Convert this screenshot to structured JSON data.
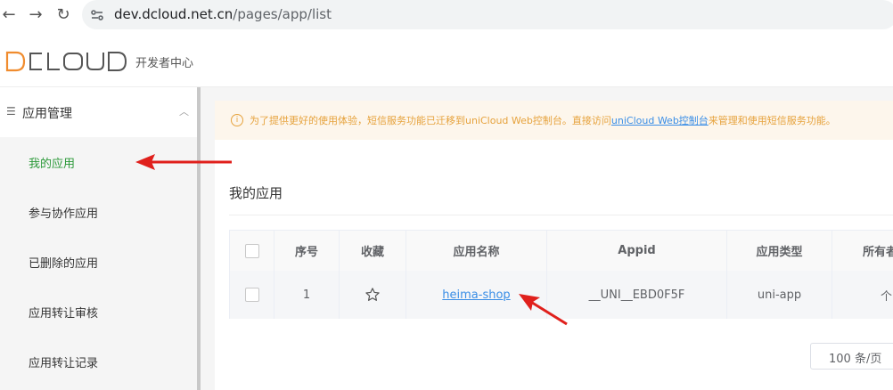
{
  "browser": {
    "url_host": "dev.dcloud.net.cn",
    "url_path": "/pages/app/list"
  },
  "header": {
    "logo_text": "DCLOUD",
    "subtitle": "开发者中心"
  },
  "sidebar": {
    "group_label": "应用管理",
    "items": [
      {
        "label": "我的应用",
        "active": true
      },
      {
        "label": "参与协作应用"
      },
      {
        "label": "已删除的应用"
      },
      {
        "label": "应用转让审核"
      },
      {
        "label": "应用转让记录"
      }
    ]
  },
  "notice": {
    "text_before": "为了提供更好的使用体验，短信服务功能已迁移到uniCloud Web控制台。直接访问",
    "link_text": "uniCloud Web控制台",
    "text_after": "来管理和使用短信服务功能。"
  },
  "main": {
    "section_title": "我的应用",
    "table": {
      "headers": [
        "序号",
        "收藏",
        "应用名称",
        "Appid",
        "应用类型",
        "所有者"
      ],
      "rows": [
        {
          "index": "1",
          "name": "heima-shop",
          "appid": "__UNI__EBD0F5F",
          "type": "uni-app",
          "owner": "个"
        }
      ]
    },
    "pager_label": "100 条/页"
  },
  "colors": {
    "active_green": "#2b9939",
    "notice_orange": "#e6a23c",
    "link_blue": "#3a8ee6",
    "annotation_red": "#e0201c"
  }
}
